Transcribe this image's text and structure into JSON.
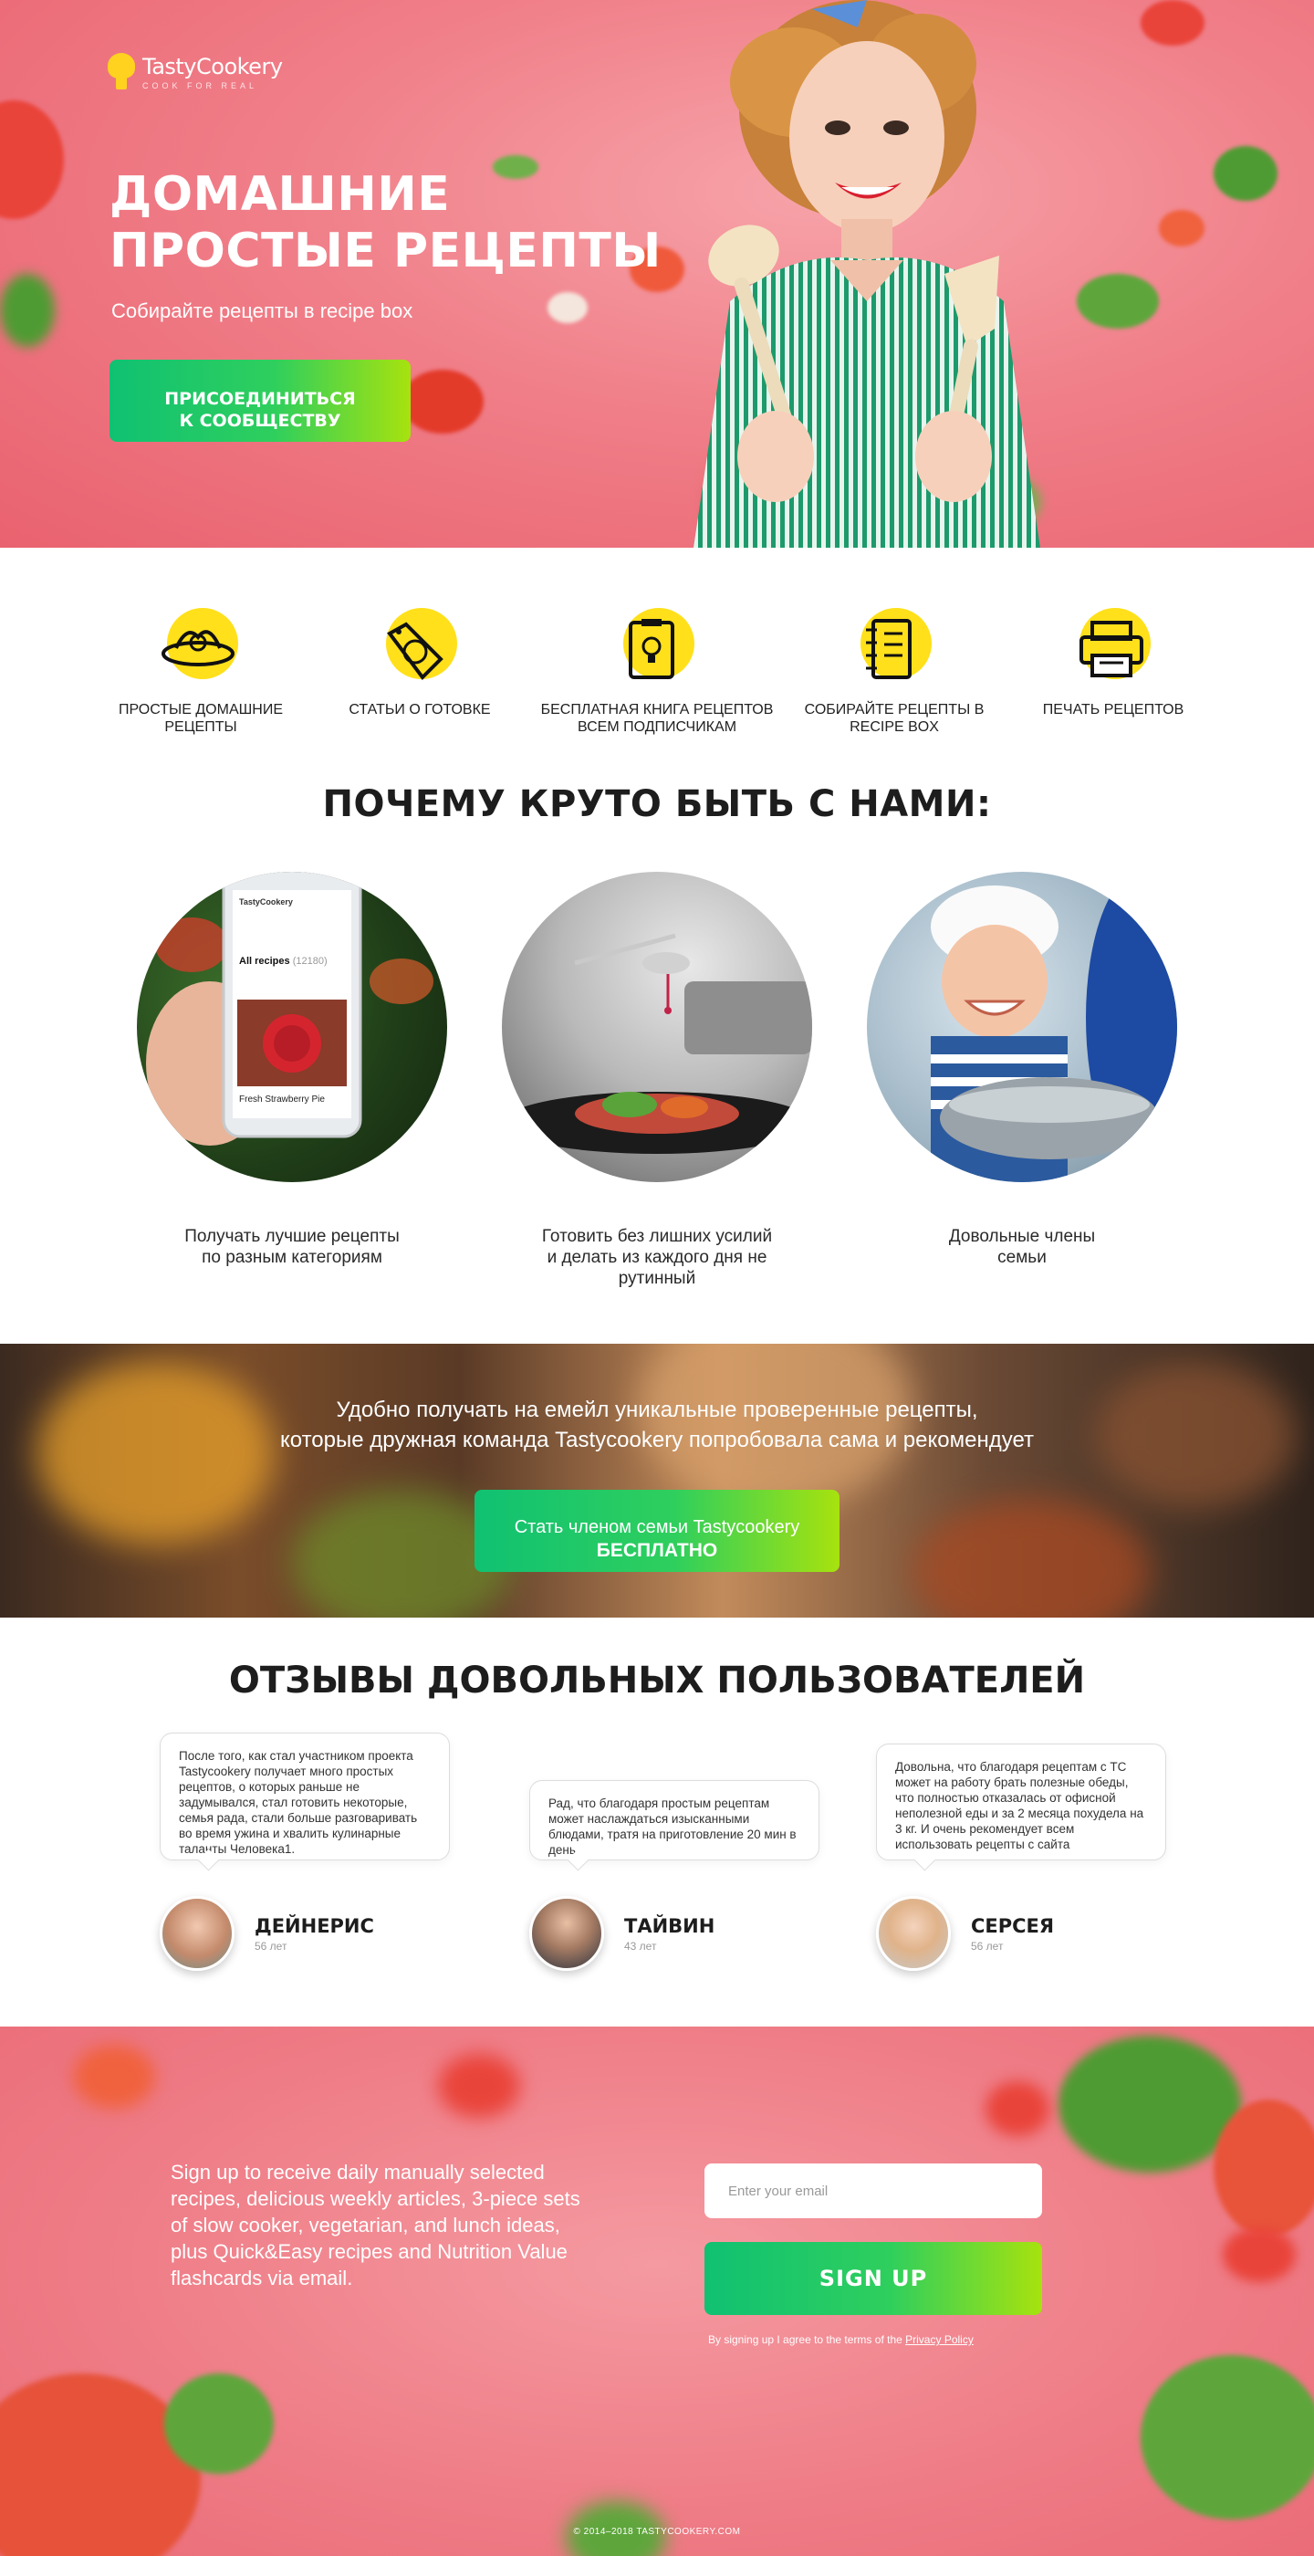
{
  "brand": {
    "name": "TastyCookery",
    "tagline": "COOK FOR REAL"
  },
  "hero": {
    "title": "ДОМАШНИЕ ПРОСТЫЕ РЕЦЕПТЫ",
    "subtitle": "Собирайте рецепты в recipe box",
    "button_line1": "ПРИСОЕДИНИТЬСЯ",
    "button_line2": "К СООБЩЕСТВУ"
  },
  "features": [
    {
      "label": "ПРОСТЫЕ ДОМАШНИЕ РЕЦЕПТЫ",
      "icon": "pasta-plate-icon"
    },
    {
      "label": "СТАТЬИ О ГОТОВКЕ",
      "icon": "tomato-tag-icon"
    },
    {
      "label": "БЕСПЛАТНАЯ КНИГА РЕЦЕПТОВ ВСЕМ ПОДПИСЧИКАМ",
      "icon": "idea-clipboard-icon"
    },
    {
      "label": "СОБИРАЙТЕ РЕЦЕПТЫ В RECIPE BOX",
      "icon": "notebook-icon"
    },
    {
      "label": "ПЕЧАТЬ РЕЦЕПТОВ",
      "icon": "printer-icon"
    }
  ],
  "why": {
    "title": "ПОЧЕМУ КРУТО БЫТЬ С НАМИ:",
    "items": [
      {
        "caption": "Получать лучшие рецепты по разным категориям"
      },
      {
        "caption": "Готовить без лишних усилий и делать из каждого дня не рутинный"
      },
      {
        "caption": "Довольные члены семьи"
      }
    ],
    "phone": {
      "brand": "TastyCookery",
      "heading": "All recipes",
      "count": "(12180)",
      "dish": "Fresh Strawberry Pie"
    }
  },
  "band": {
    "line1": "Удобно получать на емейл уникальные проверенные рецепты,",
    "line2": "которые дружная команда Tastycookery попробовала сама и рекомендует",
    "button_line1": "Стать членом семьи Tastycookery",
    "button_line2": "БЕСПЛАТНО"
  },
  "reviews": {
    "title": "ОТЗЫВЫ ДОВОЛЬНЫХ ПОЛЬЗОВАТЕЛЕЙ",
    "items": [
      {
        "text": "После того, как стал участником проекта Tastycookery получает много простых рецептов, о которых раньше не задумывался, стал готовить некоторые, семья рада, стали больше разговаривать во время ужина и хвалить кулинарные таланты Человека1.",
        "name": "ДЕЙНЕРИС",
        "age": "56 лет"
      },
      {
        "text": "Рад, что благодаря простым рецептам может наслаждаться изысканными блюдами, тратя на приготовление 20 мин в день",
        "name": "ТАЙВИН",
        "age": "43 лет"
      },
      {
        "text": "Довольна, что благодаря рецептам с ТС может на работу брать полезные обеды, что полностью отказалась от офисной неполезной еды и за 2 месяца похудела на 3 кг. И очень рекомендует всем использовать рецепты с сайта",
        "name": "СЕРСЕЯ",
        "age": "56 лет"
      }
    ]
  },
  "signup": {
    "text": "Sign up to receive daily manually selected recipes, delicious weekly articles, 3-piece sets of slow cooker, vegetarian, and lunch ideas, plus Quick&Easy recipes and Nutrition Value flashcards via email.",
    "email_placeholder": "Enter your email",
    "button": "SIGN UP",
    "terms_prefix": "By signing up I agree to the terms of the",
    "terms_link": "Privacy Policy",
    "copyright": "© 2014–2018 TASTYCOOKERY.COM"
  },
  "colors": {
    "accent_green": "#10c172",
    "accent_lime": "#a7e20e",
    "hero_pink": "#f07f89",
    "icon_yellow": "#ffe01a"
  }
}
